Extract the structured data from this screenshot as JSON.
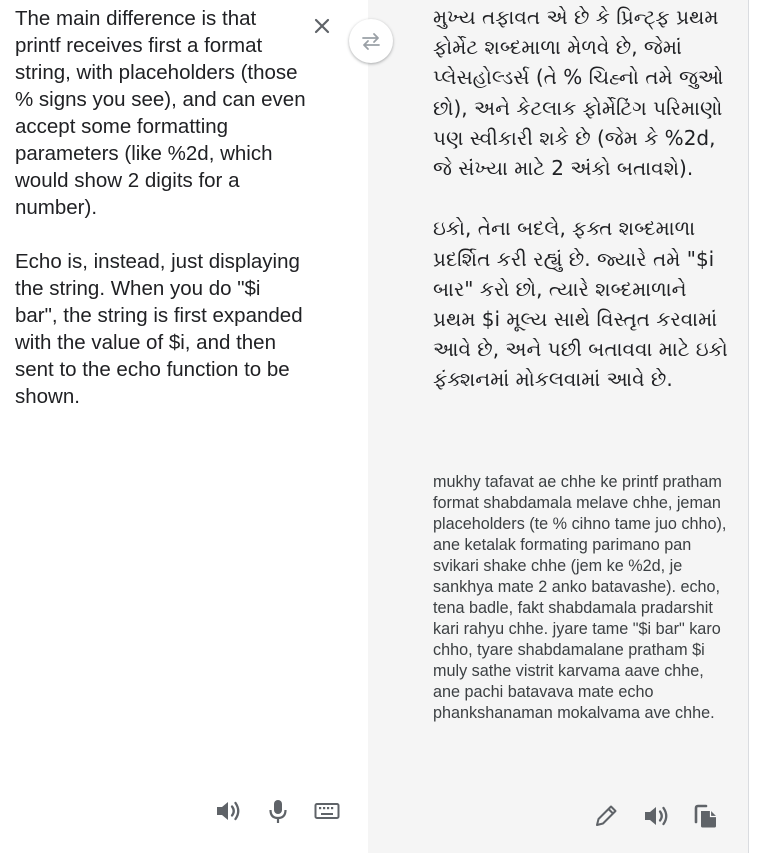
{
  "source": {
    "text": "The main difference is that printf receives first a format string, with placeholders (those % signs you see), and can even accept some formatting parameters (like %2d, which would show 2 digits for a number).\n\nEcho is, instead, just displaying the string. When you do \"$i bar\", the string is first expanded with the value of $i, and then sent to the echo function to be shown."
  },
  "translation": {
    "text": "મુખ્ય તફાવત એ છે કે પ્રિન્ટ્ફ પ્રથમ ફોર્મેટ શબ્દમાળા મેળવે છે, જેમાં પ્લેસહોલ્ડર્સ (તે % ચિહ્નો તમે જુઓ છો), અને કેટલાક ફોર્મેટિંગ પરિમાણો પણ સ્વીકારી શકે છે (જેમ કે %2d, જે સંખ્યા માટે 2 અંકો બતાવશે).\n\nઇકો, તેના બદલે, ફક્ત શબ્દમાળા પ્રદર્શિત કરી રહ્યું છે. જ્યારે તમે \"$i બાર\" કરો છો, ત્યારે શબ્દમાળાને પ્રથમ $i મૂલ્ય સાથે વિસ્તૃત કરવામાં આવે છે, અને પછી બતાવવા માટે ઇકો ફંક્શનમાં મોકલવામાં આવે છે.",
    "transliteration": "mukhy tafavat ae chhe ke printf pratham format shabdamala melave chhe, jeman placeholders (te % cihno tame juo chho), ane ketalak formating parimano pan svikari shake chhe (jem ke %2d, je sankhya mate 2 anko batavashe). echo, tena badle, fakt shabdamala pradarshit kari rahyu chhe. jyare tame \"$i bar\" karo chho, tyare shabdamalane pratham $i muly sathe vistrit karvama aave chhe, ane pachi batavava mate echo phankshanaman mokalvama ave chhe."
  },
  "icons": {
    "close": "close-icon",
    "swap": "swap-languages-icon",
    "source_listen": "speaker-icon",
    "voice_input": "microphone-icon",
    "keyboard": "keyboard-icon",
    "edit": "pencil-icon",
    "translation_listen": "speaker-icon",
    "copy": "copy-icon"
  },
  "colors": {
    "icon": "#5f6368",
    "text": "#202124",
    "translation_bg": "#f5f5f5"
  }
}
